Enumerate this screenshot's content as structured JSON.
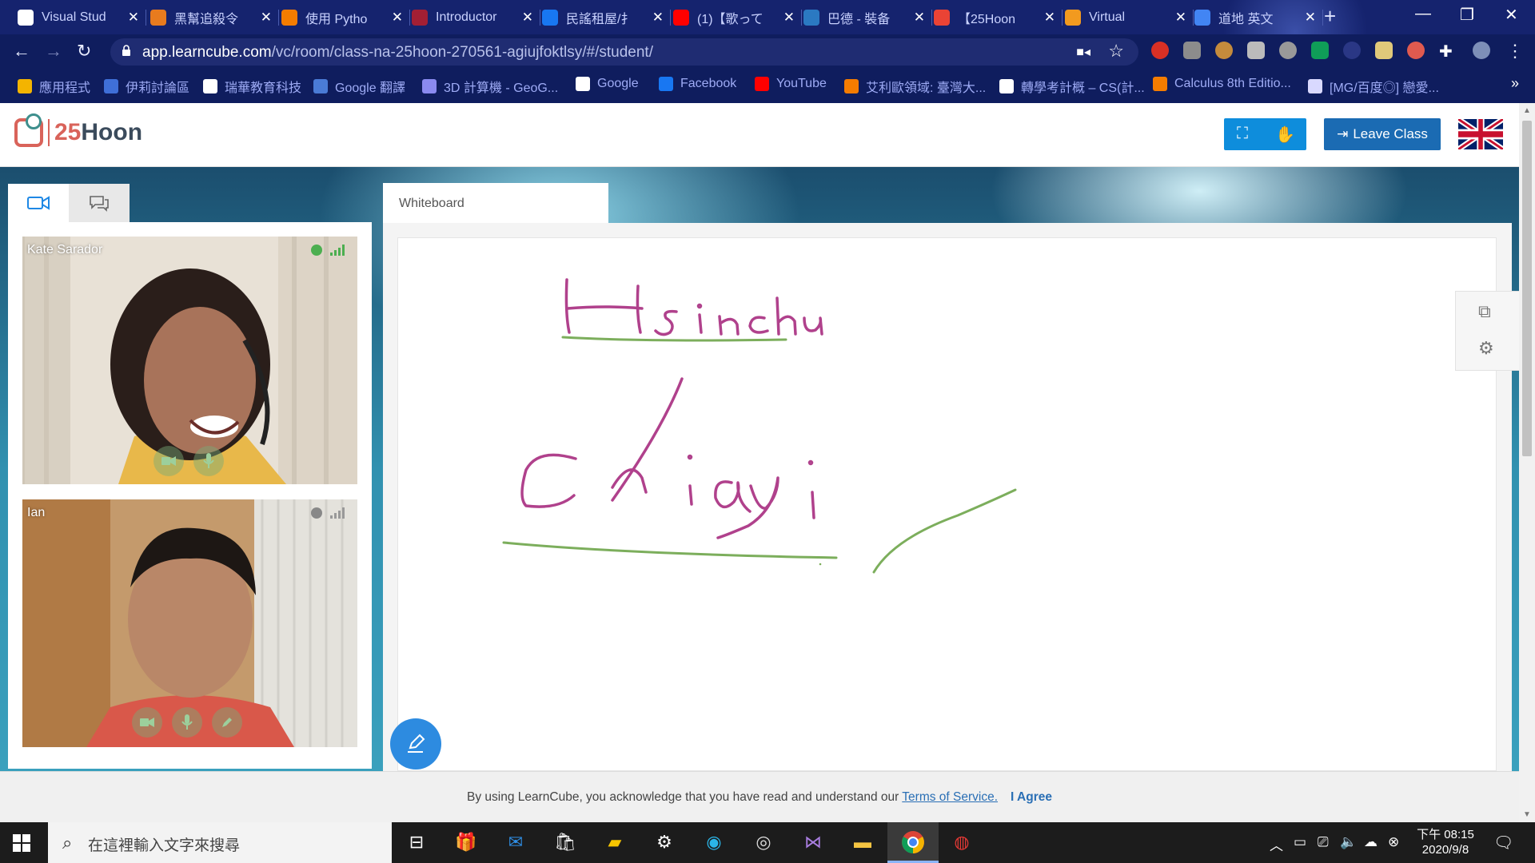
{
  "browser": {
    "tabs": [
      {
        "label": "Visual Stud",
        "color": "#ffffff"
      },
      {
        "label": "黑幫追殺令",
        "color": "#e87b1e"
      },
      {
        "label": "使用 Pytho",
        "color": "#f57c00"
      },
      {
        "label": "Introductor",
        "color": "#a31f34"
      },
      {
        "label": "民謠租屋/扌",
        "color": "#1877f2"
      },
      {
        "label": "(1)【歌って",
        "color": "#ff0000"
      },
      {
        "label": "巴德 - 裝备",
        "color": "#2b79c2"
      },
      {
        "label": "【25Hoon",
        "color": "#ea4335"
      },
      {
        "label": "Virtual",
        "color": "#f29a1f"
      },
      {
        "label": "道地 英文",
        "color": "#4285f4"
      }
    ],
    "url_host": "app.learncube.com",
    "url_path": "/vc/room/class-na-25hoon-270561-agiujfoktlsy/#/student/",
    "bookmarks": [
      {
        "label": "應用程式",
        "color": "#f4b400"
      },
      {
        "label": "伊莉討論區",
        "color": "#3f6fd8"
      },
      {
        "label": "瑞華教育科技",
        "color": "#ffffff"
      },
      {
        "label": "Google 翻譯",
        "color": "#4a7bd6"
      },
      {
        "label": "3D 計算機 - GeoG...",
        "color": "#8a8af0"
      },
      {
        "label": "Google",
        "color": "#ffffff"
      },
      {
        "label": "Facebook",
        "color": "#1877f2"
      },
      {
        "label": "YouTube",
        "color": "#ff0000"
      },
      {
        "label": "艾利歐領域: 臺灣大...",
        "color": "#f57c00"
      },
      {
        "label": "轉學考計概 – CS(計...",
        "color": "#ffffff"
      },
      {
        "label": "Calculus 8th Editio...",
        "color": "#f57c00"
      },
      {
        "label": "[MG/百度◎] 戀愛...",
        "color": "#d9d9ff"
      }
    ]
  },
  "app": {
    "logo_number": "25",
    "logo_word": "Hoon",
    "leave_label": "Leave Class",
    "whiteboard_tab": "Whiteboard",
    "participants": [
      {
        "name": "Kate Sarador",
        "status_color": "#4caf50"
      },
      {
        "name": "Ian",
        "status_color": "#888888"
      }
    ],
    "handwriting": [
      "Hsinchu",
      "Chiayi"
    ],
    "cookie": {
      "text": "By using LearnCube, you acknowledge that you have read and understand our",
      "tos": "Terms of Service.",
      "agree": "I Agree"
    },
    "colors": {
      "accent": "#0e8ddc",
      "leave": "#1b6bb3",
      "pen": "#b0418c",
      "underline": "#7cae5c"
    }
  },
  "taskbar": {
    "search_placeholder": "在這裡輸入文字來搜尋",
    "time": "下午 08:15",
    "date": "2020/9/8"
  }
}
